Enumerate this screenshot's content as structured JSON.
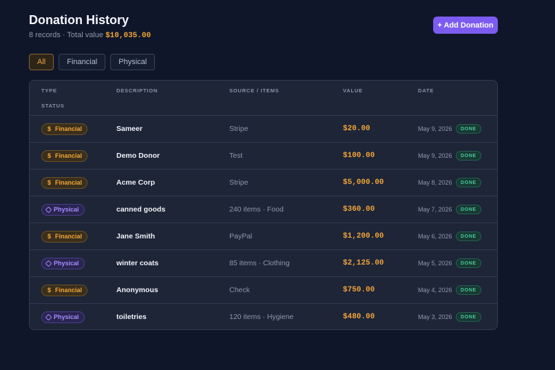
{
  "page": {
    "title": "Donation History",
    "subtitle_prefix": "8 records · Total value ",
    "total_value": "$10,035.00"
  },
  "actions": {
    "add_label": "+ Add Donation"
  },
  "filters": [
    {
      "label": "All",
      "active": true
    },
    {
      "label": "Financial",
      "active": false
    },
    {
      "label": "Physical",
      "active": false
    }
  ],
  "table": {
    "headers": {
      "type": "TYPE",
      "description": "DESCRIPTION",
      "source": "SOURCE / ITEMS",
      "value": "VALUE",
      "date": "DATE",
      "status": "STATUS"
    },
    "rows": [
      {
        "type": "Financial",
        "icon": "dollar-icon",
        "description": "Sameer",
        "source": "Stripe",
        "value": "$20.00",
        "date": "May 9, 2026",
        "status": "DONE"
      },
      {
        "type": "Financial",
        "icon": "dollar-icon",
        "description": "Demo Donor",
        "source": "Test",
        "value": "$100.00",
        "date": "May 9, 2026",
        "status": "DONE"
      },
      {
        "type": "Financial",
        "icon": "dollar-icon",
        "description": "Acme Corp",
        "source": "Stripe",
        "value": "$5,000.00",
        "date": "May 8, 2026",
        "status": "DONE"
      },
      {
        "type": "Physical",
        "icon": "box-icon",
        "description": "canned goods",
        "source": "240 items · Food",
        "value": "$360.00",
        "date": "May 7, 2026",
        "status": "DONE"
      },
      {
        "type": "Financial",
        "icon": "dollar-icon",
        "description": "Jane Smith",
        "source": "PayPal",
        "value": "$1,200.00",
        "date": "May 6, 2026",
        "status": "DONE"
      },
      {
        "type": "Physical",
        "icon": "box-icon",
        "description": "winter coats",
        "source": "85 items · Clothing",
        "value": "$2,125.00",
        "date": "May 5, 2026",
        "status": "DONE"
      },
      {
        "type": "Financial",
        "icon": "dollar-icon",
        "description": "Anonymous",
        "source": "Check",
        "value": "$750.00",
        "date": "May 4, 2026",
        "status": "DONE"
      },
      {
        "type": "Physical",
        "icon": "box-icon",
        "description": "toiletries",
        "source": "120 items · Hygiene",
        "value": "$480.00",
        "date": "May 3, 2026",
        "status": "DONE"
      }
    ]
  },
  "colors": {
    "accent": "#7c5cf0",
    "value": "#f0a43a",
    "financial": "#f0a43a",
    "physical": "#a58cff",
    "done": "#49c79a",
    "background": "#0f1629"
  }
}
